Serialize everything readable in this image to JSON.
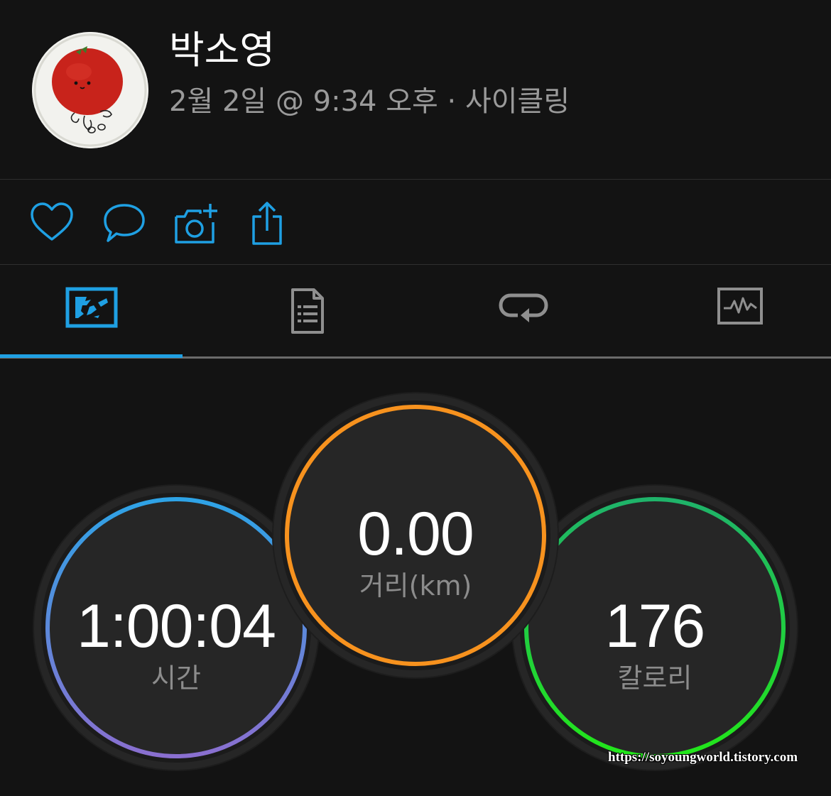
{
  "profile": {
    "name": "박소영",
    "avatar_icon": "tomato-character-avatar",
    "date": "2월 2일",
    "at": "@",
    "time": "9:34 오후",
    "separator": "·",
    "activity_type": "사이클링"
  },
  "actions": [
    {
      "icon": "heart-icon",
      "name": "like"
    },
    {
      "icon": "comment-icon",
      "name": "comment"
    },
    {
      "icon": "camera-add-icon",
      "name": "add-photo"
    },
    {
      "icon": "share-icon",
      "name": "share"
    }
  ],
  "tabs": [
    {
      "icon": "map-overview-icon",
      "active": true
    },
    {
      "icon": "details-list-icon",
      "active": false
    },
    {
      "icon": "laps-icon",
      "active": false
    },
    {
      "icon": "charts-icon",
      "active": false
    }
  ],
  "stats": {
    "time": {
      "value": "1:00:04",
      "label": "시간"
    },
    "distance": {
      "value": "0.00",
      "label": "거리(km)"
    },
    "calories": {
      "value": "176",
      "label": "칼로리"
    }
  },
  "watermark": "https://soyoungworld.tistory.com",
  "colors": {
    "accent": "#1fa0e3",
    "time_ring_start": "#2ea3e6",
    "time_ring_end": "#8a6fd0",
    "distance_ring": "#f7921e",
    "calories_ring_start": "#1fb36a",
    "calories_ring_end": "#22e61a"
  }
}
